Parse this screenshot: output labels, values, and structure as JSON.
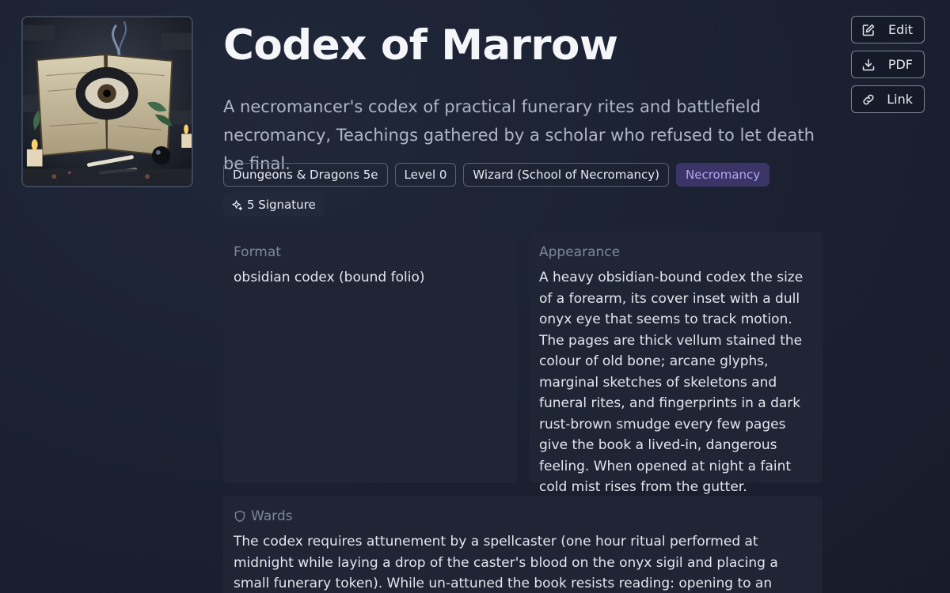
{
  "title": "Codex of Marrow",
  "description": "A necromancer's codex of practical funerary rites and battlefield necromancy, Teachings gathered by a scholar who refused to let death be final.",
  "tags": [
    {
      "label": "Dungeons & Dragons 5e"
    },
    {
      "label": "Level 0"
    },
    {
      "label": "Wizard (School of Necromancy)"
    },
    {
      "label": "Necromancy"
    }
  ],
  "signature": {
    "label": "5 Signature",
    "icon": "sparkle-icon"
  },
  "actions": {
    "edit_label": "Edit",
    "pdf_label": "PDF",
    "link_label": "Link"
  },
  "cards": {
    "format": {
      "label": "Format",
      "text": "obsidian codex (bound folio)"
    },
    "appearance": {
      "label": "Appearance",
      "text": "A heavy obsidian-bound codex the size of a forearm, its cover inset with a dull onyx eye that seems to track motion. The pages are thick vellum stained the colour of old bone; arcane glyphs, marginal sketches of skeletons and funeral rites, and fingerprints in a dark rust-brown smudge every few pages give the book a lived-in, dangerous feeling. When opened at night a faint cold mist rises from the gutter."
    },
    "wards": {
      "label": "Wards",
      "icon": "shield-icon",
      "text": "The codex requires attunement by a spellcaster (one hour ritual performed at midnight while laying a drop of the caster's blood on the onyx sigil and placing a small funerary token). While un-attuned the book resists reading: opening to an arcane page without attunement"
    }
  },
  "colors": {
    "background": "#1b2132",
    "card": "#1f2535",
    "accent_tag_bg": "#3b3466",
    "accent_tag_text": "#b5a4f4"
  }
}
